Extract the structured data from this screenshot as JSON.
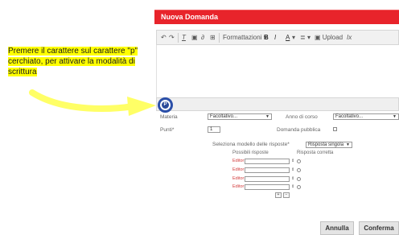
{
  "dialog": {
    "title": "Nuova Domanda"
  },
  "toolbar": {
    "formatting_label": "Formattazioni",
    "bold": "B",
    "italic": "I",
    "underline": "A",
    "upload_label": "Upload",
    "clear_format": "Ix"
  },
  "annotation": {
    "text_line1": "Premere il carattere sul carattere \"p\"",
    "text_line2": "cerchiato, per attivare la modalità di",
    "text_line3": "scrittura"
  },
  "circle_letter": "P",
  "form": {
    "materia_label": "Materia",
    "materia_value": "Facoltativo...",
    "anno_label": "Anno di corso",
    "anno_value": "Facoltativo...",
    "punti_label": "Punti*",
    "punti_value": "1",
    "pubblica_label": "Domanda pubblica",
    "modello_label": "Seleziona modello delle risposte*",
    "modello_value": "Risposta singola",
    "possibili_label": "Possibili risposte",
    "corretta_label": "Risposta corretta",
    "editor_label": "Editor",
    "add_btn": "+",
    "remove_btn": "−"
  },
  "buttons": {
    "annulla": "Annulla",
    "conferma": "Conferma"
  },
  "colors": {
    "header": "#e8242b",
    "arrow": "#ffff66",
    "circle": "#2b4fa8",
    "annotation_highlight": "#ffff00"
  }
}
